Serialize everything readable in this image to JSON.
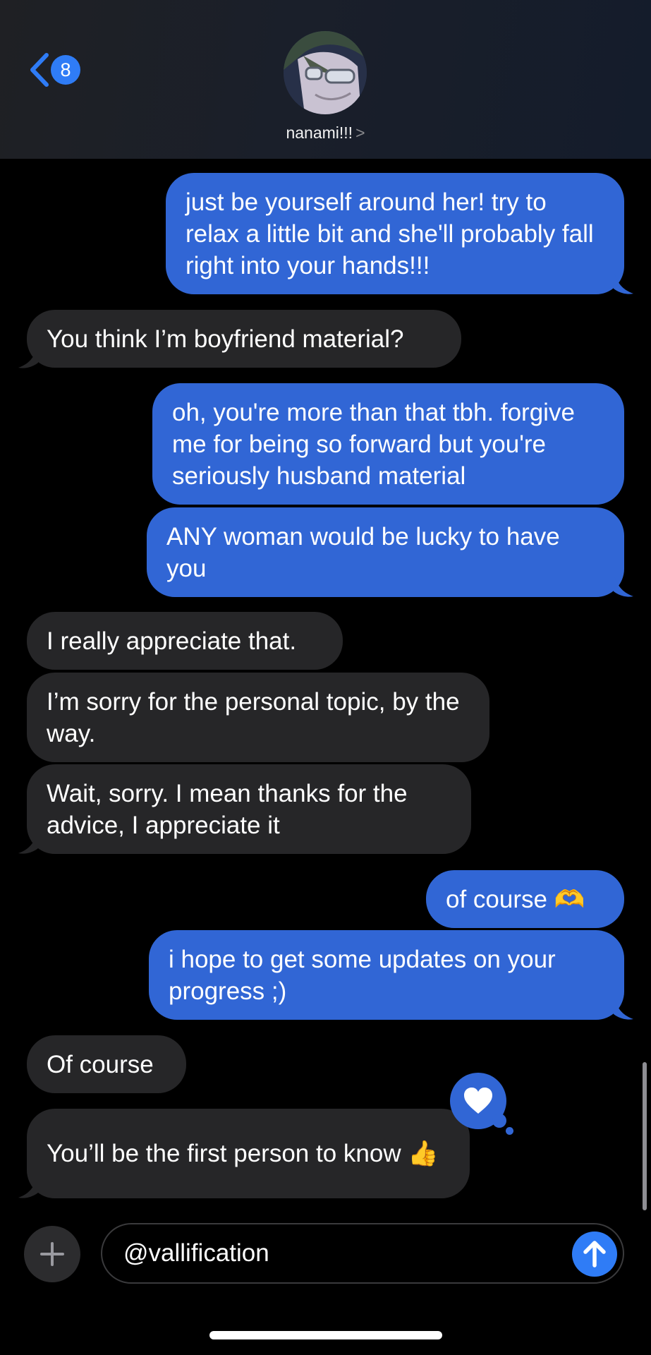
{
  "header": {
    "back_count": "8",
    "contact_name": "nanami!!!",
    "contact_chevron": ">"
  },
  "messages": [
    {
      "from": "me",
      "text": "just be yourself around her! try to relax a little bit and she'll probably fall right into your hands!!!"
    },
    {
      "from": "them",
      "text": "You think I’m boyfriend material?"
    },
    {
      "from": "me",
      "text": "oh, you're more than that tbh. forgive me for being so forward but you're seriously husband material"
    },
    {
      "from": "me",
      "text": "ANY woman would be lucky to have you"
    },
    {
      "from": "them",
      "text": "I really appreciate that."
    },
    {
      "from": "them",
      "text": "I’m sorry for the personal topic, by the way."
    },
    {
      "from": "them",
      "text": "Wait, sorry. I mean thanks for the advice, I appreciate it"
    },
    {
      "from": "me",
      "text": "of course 🫶"
    },
    {
      "from": "me",
      "text": "i hope to get some updates on your progress ;)"
    },
    {
      "from": "them",
      "text": "Of course"
    },
    {
      "from": "them",
      "text": "You’ll be the first person to know 👍"
    }
  ],
  "reaction": {
    "icon": "heart-icon"
  },
  "composer": {
    "plus_icon": "plus-icon",
    "input_value": "@vallification",
    "send_icon": "arrow-up-icon"
  },
  "colors": {
    "sent_bubble": "#3166d5",
    "received_bubble": "#262628",
    "accent": "#2f7cf6",
    "background": "#000000"
  }
}
